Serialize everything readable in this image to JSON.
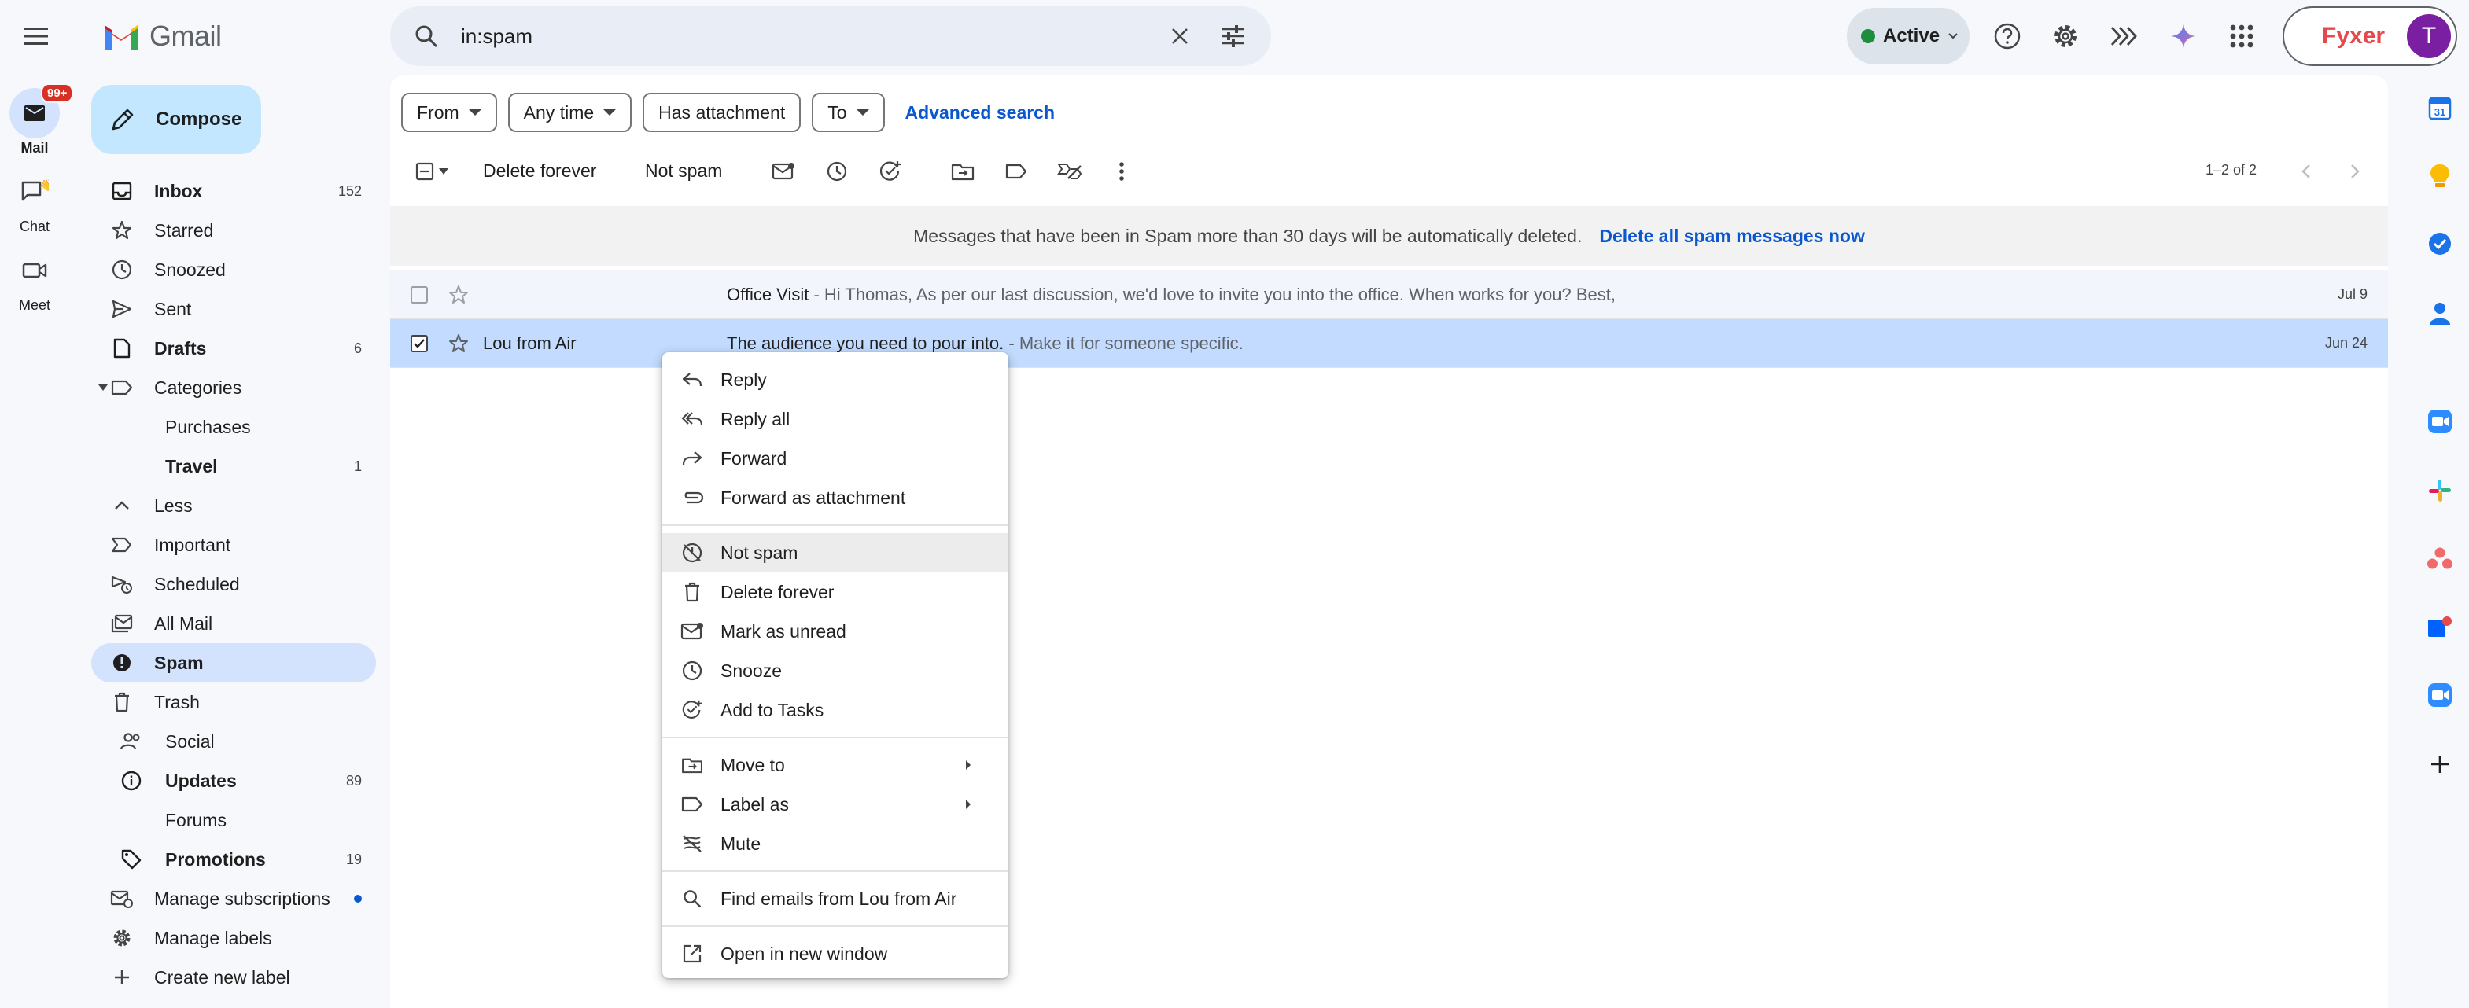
{
  "app": {
    "logo_text": "Gmail"
  },
  "search": {
    "value": "in:spam"
  },
  "header": {
    "status_label": "Active",
    "fyxer_label": "Fyxer",
    "avatar_letter": "T"
  },
  "rail": {
    "mail_label": "Mail",
    "mail_badge": "99+",
    "chat_label": "Chat",
    "meet_label": "Meet"
  },
  "compose_label": "Compose",
  "sidebar": {
    "items": [
      {
        "label": "Inbox",
        "count": "152",
        "icon": "inbox-icon",
        "bold": true
      },
      {
        "label": "Starred",
        "count": "",
        "icon": "star-icon"
      },
      {
        "label": "Snoozed",
        "count": "",
        "icon": "clock-icon"
      },
      {
        "label": "Sent",
        "count": "",
        "icon": "send-icon"
      },
      {
        "label": "Drafts",
        "count": "6",
        "icon": "draft-icon",
        "bold": true
      },
      {
        "label": "Categories",
        "count": "",
        "icon": "label-icon"
      },
      {
        "label": "Purchases",
        "count": "",
        "icon": ""
      },
      {
        "label": "Travel",
        "count": "1",
        "icon": "",
        "bold": true
      },
      {
        "label": "Less",
        "count": "",
        "icon": "chevron-up-icon"
      },
      {
        "label": "Important",
        "count": "",
        "icon": "important-icon"
      },
      {
        "label": "Scheduled",
        "count": "",
        "icon": "scheduled-icon"
      },
      {
        "label": "All Mail",
        "count": "",
        "icon": "all-mail-icon"
      },
      {
        "label": "Spam",
        "count": "",
        "icon": "spam-icon",
        "bold": true
      },
      {
        "label": "Trash",
        "count": "",
        "icon": "trash-icon"
      },
      {
        "label": "Social",
        "count": "",
        "icon": "social-icon"
      },
      {
        "label": "Updates",
        "count": "89",
        "icon": "info-icon",
        "bold": true
      },
      {
        "label": "Forums",
        "count": "",
        "icon": "forum-icon"
      },
      {
        "label": "Promotions",
        "count": "19",
        "icon": "tag-icon",
        "bold": true
      },
      {
        "label": "Manage subscriptions",
        "count": "",
        "icon": "subscriptions-icon"
      },
      {
        "label": "Manage labels",
        "count": "",
        "icon": "gear-icon"
      },
      {
        "label": "Create new label",
        "count": "",
        "icon": "plus-icon"
      }
    ]
  },
  "filters": {
    "from": "From",
    "any_time": "Any time",
    "has_attachment": "Has attachment",
    "to": "To",
    "advanced_search": "Advanced search"
  },
  "toolbar": {
    "delete_forever": "Delete forever",
    "not_spam": "Not spam",
    "pager": "1–2 of 2"
  },
  "notice": {
    "text": "Messages that have been in Spam more than 30 days will be automatically deleted.",
    "link": "Delete all spam messages now"
  },
  "emails": [
    {
      "sender": "",
      "subject": "Office Visit",
      "snippet": " - Hi Thomas, As per our last discussion, we'd love to invite you into the office. When works for you? Best,",
      "date": "Jul 9",
      "selected": false
    },
    {
      "sender": "Lou from Air",
      "subject": "The audience you need to pour into.",
      "snippet": " - Make it for someone specific.",
      "date": "Jun 24",
      "selected": true
    }
  ],
  "context_menu": {
    "reply": "Reply",
    "reply_all": "Reply all",
    "forward": "Forward",
    "forward_attachment": "Forward as attachment",
    "not_spam": "Not spam",
    "delete_forever": "Delete forever",
    "mark_unread": "Mark as unread",
    "snooze": "Snooze",
    "add_tasks": "Add to Tasks",
    "move_to": "Move to",
    "label_as": "Label as",
    "mute": "Mute",
    "find_emails": "Find emails from Lou from Air",
    "open_new_window": "Open in new window"
  },
  "colors": {
    "accent": "#0b57d0",
    "compose_bg": "#c2e7ff",
    "active_nav": "#d3e3fd",
    "selected_row": "#c2dbff",
    "badge": "#d93025",
    "status_green": "#1e8e3e",
    "fyxer_red": "#e5484d",
    "avatar": "#7b1fa2"
  }
}
